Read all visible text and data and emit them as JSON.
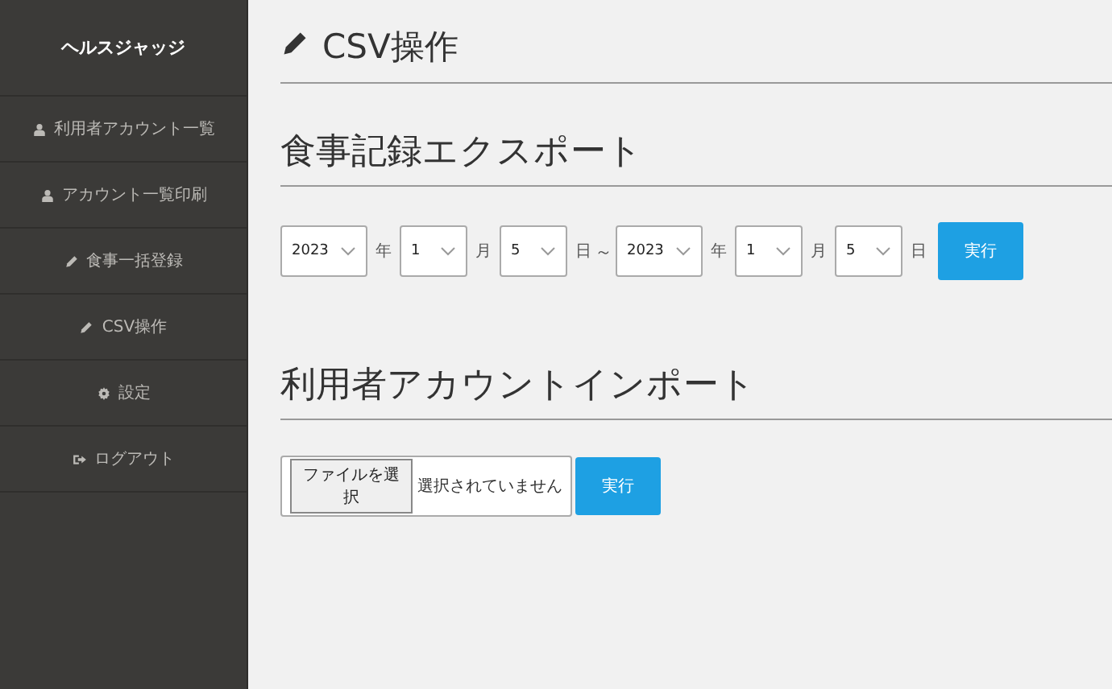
{
  "sidebar": {
    "title": "ヘルスジャッジ",
    "items": [
      {
        "label": "利用者アカウント一覧",
        "kind": "user"
      },
      {
        "label": "アカウント一覧印刷",
        "kind": "user"
      },
      {
        "label": "食事一括登録",
        "kind": "pencil"
      },
      {
        "label": "CSV操作",
        "kind": "pencil"
      },
      {
        "label": "設定",
        "kind": "gear"
      },
      {
        "label": "ログアウト",
        "kind": "logout"
      }
    ]
  },
  "page": {
    "title": "CSV操作"
  },
  "export": {
    "heading": "食事記録エクスポート",
    "from": [
      {
        "value": "2023",
        "unit": "年"
      },
      {
        "value": "1",
        "unit": "月"
      },
      {
        "value": "5",
        "unit": "日"
      }
    ],
    "separator": "～",
    "to": [
      {
        "value": "2023",
        "unit": "年"
      },
      {
        "value": "1",
        "unit": "月"
      },
      {
        "value": "5",
        "unit": "日"
      }
    ],
    "button": "実行"
  },
  "import": {
    "heading": "利用者アカウントインポート",
    "file_button": "ファイルを選択",
    "file_status": "選択されていません",
    "button": "実行"
  }
}
